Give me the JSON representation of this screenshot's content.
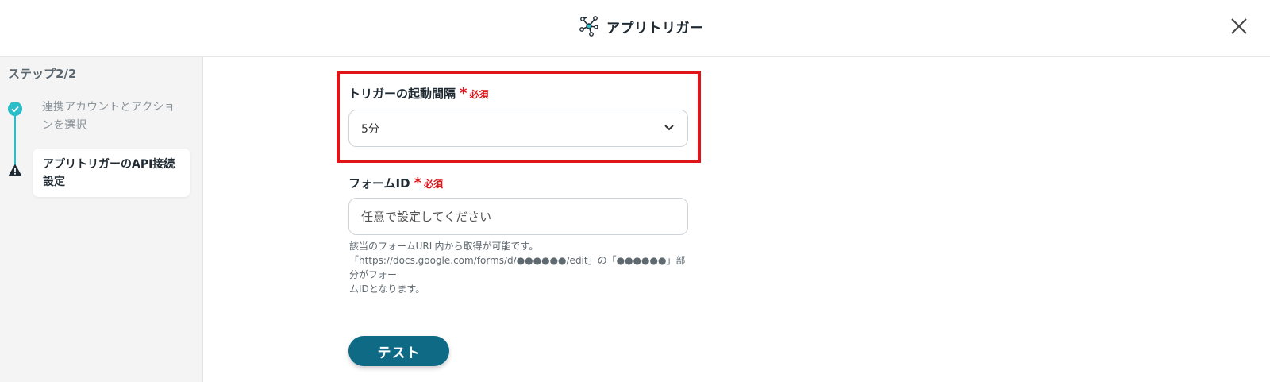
{
  "header": {
    "title": "アプリトリガー",
    "title_icon": "network-nodes-icon",
    "close_icon": "close-icon"
  },
  "sidebar": {
    "step_label": "ステップ2/2",
    "steps": [
      {
        "label": "連携アカウントとアクションを選択",
        "status": "complete",
        "icon": "check-circle-icon"
      },
      {
        "label": "アプリトリガーのAPI接続設定",
        "status": "warning",
        "icon": "warning-icon"
      }
    ]
  },
  "form": {
    "interval": {
      "label": "トリガーの起動間隔",
      "required_mark": "*",
      "required_text": "必須",
      "value": "5分"
    },
    "form_id": {
      "label": "フォームID",
      "required_mark": "*",
      "required_text": "必須",
      "value": "",
      "placeholder": "任意で設定してください",
      "help_lines": [
        "該当のフォームURL内から取得が可能です。",
        "「https://docs.google.com/forms/d/●●●●●●/edit」の「●●●●●●」部分がフォー",
        "ムIDとなります。"
      ]
    },
    "test_button": "テスト"
  },
  "colors": {
    "accent_teal": "#2bbec9",
    "button": "#0e6a85",
    "required_red": "#e0151a",
    "highlight_border": "#e0151a"
  }
}
